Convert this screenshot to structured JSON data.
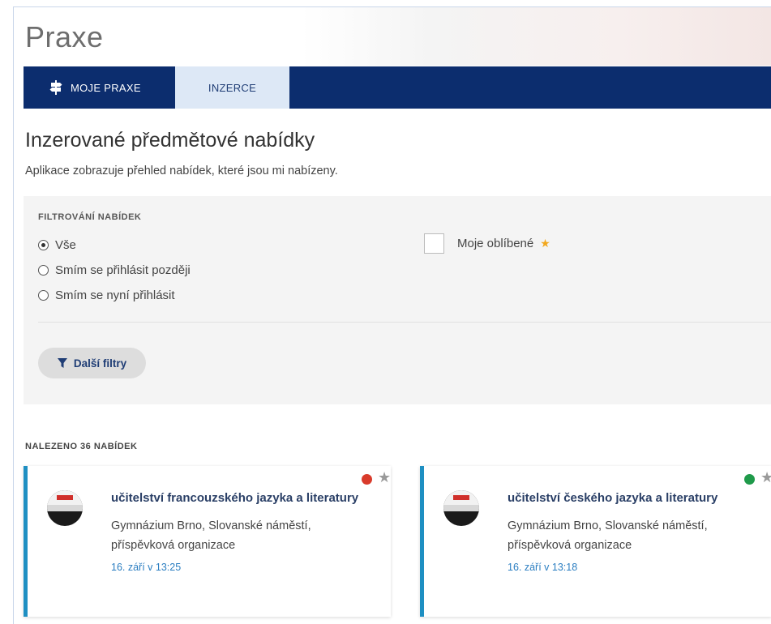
{
  "header": {
    "title": "Praxe"
  },
  "nav": {
    "tabs": [
      {
        "label": "MOJE PRAXE",
        "icon": "signpost-icon",
        "active": false
      },
      {
        "label": "INZERCE",
        "active": true
      }
    ]
  },
  "section": {
    "title": "Inzerované předmětové nabídky",
    "description": "Aplikace zobrazuje přehled nabídek, které jsou mi nabízeny."
  },
  "filters": {
    "heading": "FILTROVÁNÍ NABÍDEK",
    "options": [
      {
        "label": "Vše",
        "checked": true
      },
      {
        "label": "Smím se přihlásit později",
        "checked": false
      },
      {
        "label": "Smím se nyní přihlásit",
        "checked": false
      }
    ],
    "favorites_label": "Moje oblíbené",
    "favorites_checked": false,
    "more_filters_label": "Další filtry"
  },
  "results": {
    "count_label": "NALEZENO 36 NABÍDEK",
    "cards": [
      {
        "title": "učitelství francouzského jazyka a literatury",
        "organization": "Gymnázium Brno, Slovanské náměstí, příspěvková organizace",
        "date": "16. září v 13:25",
        "status_color": "#d93b2b"
      },
      {
        "title": "učitelství českého jazyka a literatury",
        "organization": "Gymnázium Brno, Slovanské náměstí, příspěvková organizace",
        "date": "16. září v 13:18",
        "status_color": "#1f9a4a"
      }
    ]
  },
  "colors": {
    "navbar": "#0c2d6e",
    "active_tab": "#dde8f6",
    "card_accent": "#1e8fc2",
    "favorite_star": "#f2a81d"
  }
}
